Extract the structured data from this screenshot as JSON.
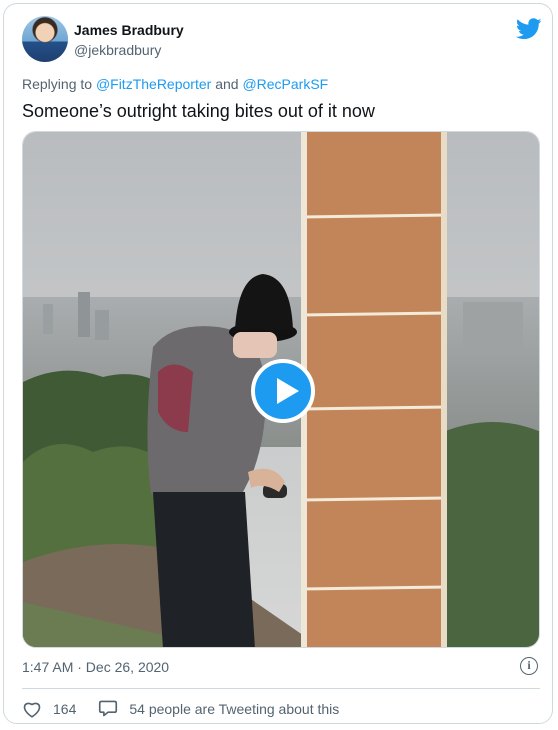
{
  "author": {
    "name": "James Bradbury",
    "handle": "@jekbradbury"
  },
  "reply": {
    "prefix": "Replying to",
    "mention1": "@FitzTheReporter",
    "conjunction": "and",
    "mention2": "@RecParkSF"
  },
  "tweet": {
    "text": "Someone’s outright taking bites out of it now",
    "timestamp": "1:47 AM · Dec 26, 2020"
  },
  "stats": {
    "likes": "164",
    "conversation": "54 people are Tweeting about this"
  },
  "icons": {
    "brand": "twitter-bird-icon",
    "play": "play-icon",
    "info": "info-icon",
    "like": "heart-icon",
    "conversation": "speech-bubble-icon"
  },
  "colors": {
    "accent": "#1d9bf0",
    "text": "#0f1419",
    "secondary": "#536471",
    "border": "#cfd9de"
  }
}
